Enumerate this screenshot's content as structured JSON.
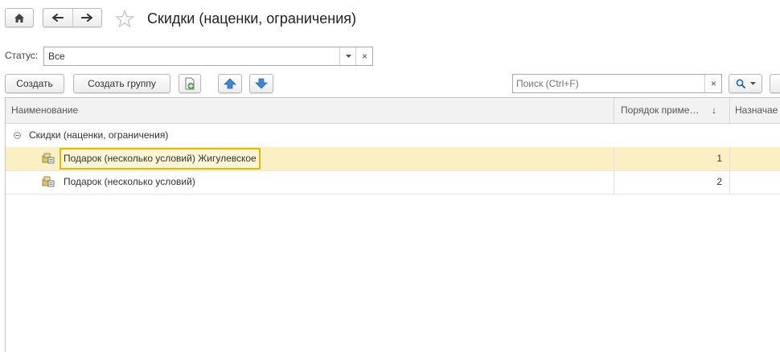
{
  "header": {
    "title": "Скидки (наценки, ограничения)",
    "home_icon": "home-icon",
    "back_icon": "arrow-left-icon",
    "forward_icon": "arrow-right-icon",
    "favorite_icon": "star-icon"
  },
  "filter": {
    "status_label": "Статус:",
    "status_value": "Все"
  },
  "toolbar": {
    "create_label": "Создать",
    "create_group_label": "Создать группу",
    "search_placeholder": "Поиск (Ctrl+F)",
    "clear_symbol": "×"
  },
  "table": {
    "columns": [
      "Наименование",
      "Порядок приме…",
      "Назначае"
    ],
    "sort_indicator": "↓",
    "group_row": {
      "label": "Скидки (наценки, ограничения)"
    },
    "rows": [
      {
        "name": "Подарок (несколько условий) Жигулевское",
        "order": "1",
        "selected": true
      },
      {
        "name": "Подарок (несколько условий)",
        "order": "2",
        "selected": false
      }
    ]
  },
  "colors": {
    "accent_blue": "#3d86d6",
    "selection_bg": "#fbefc4",
    "focus_border": "#e6b800",
    "add_icon_green": "#3aa53a"
  }
}
